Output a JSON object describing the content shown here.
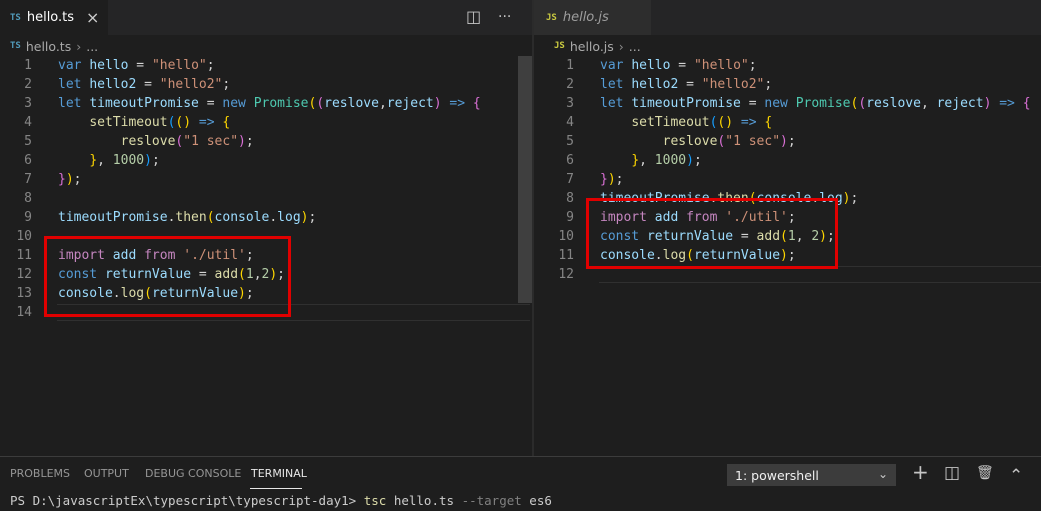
{
  "left_editor": {
    "tab": {
      "lang": "TS",
      "name": "hello.ts",
      "close": "×"
    },
    "actions": {
      "split": "◫",
      "more": "···"
    },
    "breadcrumb": {
      "lang": "TS",
      "file": "hello.ts",
      "sep": "›",
      "rest": "..."
    },
    "lines": [
      {
        "n": "1",
        "tokens": [
          [
            "kw",
            "var"
          ],
          [
            "pl",
            " "
          ],
          [
            "vr",
            "hello"
          ],
          [
            "pl",
            " = "
          ],
          [
            "st",
            "\"hello\""
          ],
          [
            "pl",
            ";"
          ]
        ]
      },
      {
        "n": "2",
        "tokens": [
          [
            "kw",
            "let"
          ],
          [
            "pl",
            " "
          ],
          [
            "vr",
            "hello2"
          ],
          [
            "pl",
            " = "
          ],
          [
            "st",
            "\"hello2\""
          ],
          [
            "pl",
            ";"
          ]
        ]
      },
      {
        "n": "3",
        "tokens": [
          [
            "kw",
            "let"
          ],
          [
            "pl",
            " "
          ],
          [
            "vr",
            "timeoutPromise"
          ],
          [
            "pl",
            " = "
          ],
          [
            "kw",
            "new"
          ],
          [
            "pl",
            " "
          ],
          [
            "cl",
            "Promise"
          ],
          [
            "b1",
            "("
          ],
          [
            "b2",
            "("
          ],
          [
            "vr",
            "reslove"
          ],
          [
            "pl",
            ","
          ],
          [
            "vr",
            "reject"
          ],
          [
            "b2",
            ")"
          ],
          [
            "pl",
            " "
          ],
          [
            "kw",
            "=>"
          ],
          [
            "pl",
            " "
          ],
          [
            "b2",
            "{"
          ]
        ]
      },
      {
        "n": "4",
        "tokens": [
          [
            "pl",
            "    "
          ],
          [
            "fn",
            "setTimeout"
          ],
          [
            "b3",
            "("
          ],
          [
            "b1",
            "()"
          ],
          [
            "pl",
            " "
          ],
          [
            "kw",
            "=>"
          ],
          [
            "pl",
            " "
          ],
          [
            "b1",
            "{"
          ]
        ]
      },
      {
        "n": "5",
        "tokens": [
          [
            "pl",
            "        "
          ],
          [
            "fn",
            "reslove"
          ],
          [
            "b2",
            "("
          ],
          [
            "st",
            "\"1 sec\""
          ],
          [
            "b2",
            ")"
          ],
          [
            "pl",
            ";"
          ]
        ]
      },
      {
        "n": "6",
        "tokens": [
          [
            "pl",
            "    "
          ],
          [
            "b1",
            "}"
          ],
          [
            "pl",
            ", "
          ],
          [
            "nm",
            "1000"
          ],
          [
            "b3",
            ")"
          ],
          [
            "pl",
            ";"
          ]
        ]
      },
      {
        "n": "7",
        "tokens": [
          [
            "b2",
            "}"
          ],
          [
            "b1",
            ")"
          ],
          [
            "pl",
            ";"
          ]
        ]
      },
      {
        "n": "8",
        "tokens": []
      },
      {
        "n": "9",
        "tokens": [
          [
            "vr",
            "timeoutPromise"
          ],
          [
            "pl",
            "."
          ],
          [
            "fn",
            "then"
          ],
          [
            "b1",
            "("
          ],
          [
            "vr",
            "console"
          ],
          [
            "pl",
            "."
          ],
          [
            "vr",
            "log"
          ],
          [
            "b1",
            ")"
          ],
          [
            "pl",
            ";"
          ]
        ]
      },
      {
        "n": "10",
        "tokens": []
      },
      {
        "n": "11",
        "tokens": [
          [
            "im",
            "import"
          ],
          [
            "pl",
            " "
          ],
          [
            "vr",
            "add"
          ],
          [
            "pl",
            " "
          ],
          [
            "im",
            "from"
          ],
          [
            "pl",
            " "
          ],
          [
            "st",
            "'./util'"
          ],
          [
            "pl",
            ";"
          ]
        ]
      },
      {
        "n": "12",
        "tokens": [
          [
            "kw",
            "const"
          ],
          [
            "pl",
            " "
          ],
          [
            "vr",
            "returnValue"
          ],
          [
            "pl",
            " = "
          ],
          [
            "fn",
            "add"
          ],
          [
            "b1",
            "("
          ],
          [
            "nm",
            "1"
          ],
          [
            "pl",
            ","
          ],
          [
            "nm",
            "2"
          ],
          [
            "b1",
            ")"
          ],
          [
            "pl",
            ";"
          ]
        ]
      },
      {
        "n": "13",
        "tokens": [
          [
            "vr",
            "console"
          ],
          [
            "pl",
            "."
          ],
          [
            "fn",
            "log"
          ],
          [
            "b1",
            "("
          ],
          [
            "vr",
            "returnValue"
          ],
          [
            "b1",
            ")"
          ],
          [
            "pl",
            ";"
          ]
        ]
      },
      {
        "n": "14",
        "tokens": []
      }
    ]
  },
  "right_editor": {
    "tab": {
      "lang": "JS",
      "name": "hello.js"
    },
    "breadcrumb": {
      "lang": "JS",
      "file": "hello.js",
      "sep": "›",
      "rest": "..."
    },
    "lines": [
      {
        "n": "1",
        "tokens": [
          [
            "kw",
            "var"
          ],
          [
            "pl",
            " "
          ],
          [
            "vr",
            "hello"
          ],
          [
            "pl",
            " = "
          ],
          [
            "st",
            "\"hello\""
          ],
          [
            "pl",
            ";"
          ]
        ]
      },
      {
        "n": "2",
        "tokens": [
          [
            "kw",
            "let"
          ],
          [
            "pl",
            " "
          ],
          [
            "vr",
            "hello2"
          ],
          [
            "pl",
            " = "
          ],
          [
            "st",
            "\"hello2\""
          ],
          [
            "pl",
            ";"
          ]
        ]
      },
      {
        "n": "3",
        "tokens": [
          [
            "kw",
            "let"
          ],
          [
            "pl",
            " "
          ],
          [
            "vr",
            "timeoutPromise"
          ],
          [
            "pl",
            " = "
          ],
          [
            "kw",
            "new"
          ],
          [
            "pl",
            " "
          ],
          [
            "cl",
            "Promise"
          ],
          [
            "b1",
            "("
          ],
          [
            "b2",
            "("
          ],
          [
            "vr",
            "reslove"
          ],
          [
            "pl",
            ", "
          ],
          [
            "vr",
            "reject"
          ],
          [
            "b2",
            ")"
          ],
          [
            "pl",
            " "
          ],
          [
            "kw",
            "=>"
          ],
          [
            "pl",
            " "
          ],
          [
            "b2",
            "{"
          ]
        ]
      },
      {
        "n": "4",
        "tokens": [
          [
            "pl",
            "    "
          ],
          [
            "fn",
            "setTimeout"
          ],
          [
            "b3",
            "("
          ],
          [
            "b1",
            "()"
          ],
          [
            "pl",
            " "
          ],
          [
            "kw",
            "=>"
          ],
          [
            "pl",
            " "
          ],
          [
            "b1",
            "{"
          ]
        ]
      },
      {
        "n": "5",
        "tokens": [
          [
            "pl",
            "        "
          ],
          [
            "fn",
            "reslove"
          ],
          [
            "b2",
            "("
          ],
          [
            "st",
            "\"1 sec\""
          ],
          [
            "b2",
            ")"
          ],
          [
            "pl",
            ";"
          ]
        ]
      },
      {
        "n": "6",
        "tokens": [
          [
            "pl",
            "    "
          ],
          [
            "b1",
            "}"
          ],
          [
            "pl",
            ", "
          ],
          [
            "nm",
            "1000"
          ],
          [
            "b3",
            ")"
          ],
          [
            "pl",
            ";"
          ]
        ]
      },
      {
        "n": "7",
        "tokens": [
          [
            "b2",
            "}"
          ],
          [
            "b1",
            ")"
          ],
          [
            "pl",
            ";"
          ]
        ]
      },
      {
        "n": "8",
        "tokens": [
          [
            "vr",
            "timeoutPromise"
          ],
          [
            "pl",
            "."
          ],
          [
            "fn",
            "then"
          ],
          [
            "b1",
            "("
          ],
          [
            "vr",
            "console"
          ],
          [
            "pl",
            "."
          ],
          [
            "vr",
            "log"
          ],
          [
            "b1",
            ")"
          ],
          [
            "pl",
            ";"
          ]
        ]
      },
      {
        "n": "9",
        "tokens": [
          [
            "im",
            "import"
          ],
          [
            "pl",
            " "
          ],
          [
            "vr",
            "add"
          ],
          [
            "pl",
            " "
          ],
          [
            "im",
            "from"
          ],
          [
            "pl",
            " "
          ],
          [
            "st",
            "'./util'"
          ],
          [
            "pl",
            ";"
          ]
        ]
      },
      {
        "n": "10",
        "tokens": [
          [
            "kw",
            "const"
          ],
          [
            "pl",
            " "
          ],
          [
            "vr",
            "returnValue"
          ],
          [
            "pl",
            " = "
          ],
          [
            "fn",
            "add"
          ],
          [
            "b1",
            "("
          ],
          [
            "nm",
            "1"
          ],
          [
            "pl",
            ", "
          ],
          [
            "nm",
            "2"
          ],
          [
            "b1",
            ")"
          ],
          [
            "pl",
            ";"
          ]
        ]
      },
      {
        "n": "11",
        "tokens": [
          [
            "vr",
            "console"
          ],
          [
            "pl",
            "."
          ],
          [
            "fn",
            "log"
          ],
          [
            "b1",
            "("
          ],
          [
            "vr",
            "returnValue"
          ],
          [
            "b1",
            ")"
          ],
          [
            "pl",
            ";"
          ]
        ]
      },
      {
        "n": "12",
        "tokens": []
      }
    ]
  },
  "panel": {
    "tabs": [
      "PROBLEMS",
      "OUTPUT",
      "DEBUG CONSOLE",
      "TERMINAL"
    ],
    "active_tab": "TERMINAL",
    "shell_select": "1: powershell",
    "icons": {
      "add": "+",
      "split": "◫",
      "trash": "🗑",
      "chevron_up": "⌃",
      "chevron_down": "⌄"
    },
    "terminal": {
      "prompt": "PS D:\\javascriptEx\\typescript\\typescript-day1> ",
      "cmd": "tsc",
      "args": " hello.ts ",
      "flag": "--target",
      "flag_value": " es6"
    }
  }
}
